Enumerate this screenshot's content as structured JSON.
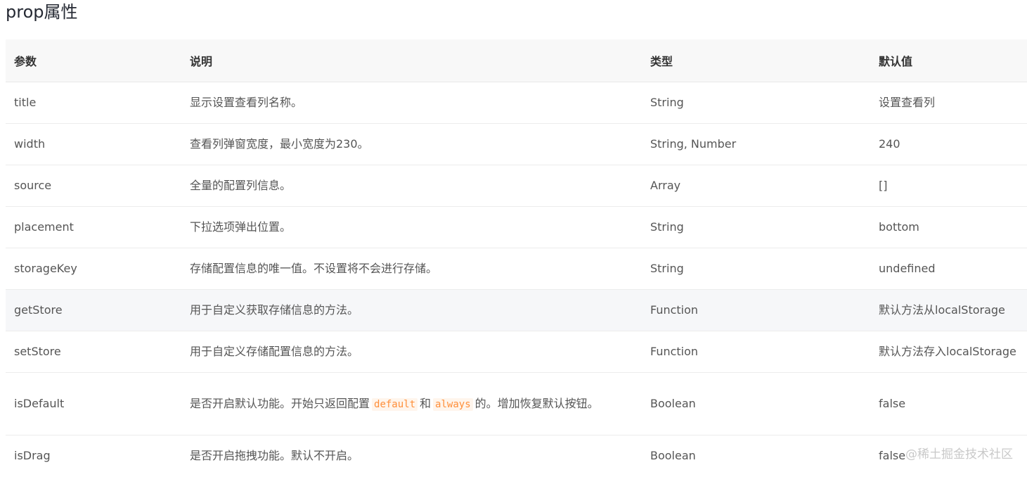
{
  "heading": "prop属性",
  "table": {
    "headers": [
      "参数",
      "说明",
      "类型",
      "默认值"
    ],
    "rows": [
      {
        "param": "title",
        "desc": "显示设置查看列名称。",
        "type": "String",
        "default": "设置查看列"
      },
      {
        "param": "width",
        "desc": "查看列弹窗宽度，最小宽度为230。",
        "type": "String, Number",
        "default": "240"
      },
      {
        "param": "source",
        "desc": "全量的配置列信息。",
        "type": "Array",
        "default": "[]"
      },
      {
        "param": "placement",
        "desc": "下拉选项弹出位置。",
        "type": "String",
        "default": "bottom"
      },
      {
        "param": "storageKey",
        "desc": "存储配置信息的唯一值。不设置将不会进行存储。",
        "type": "String",
        "default": "undefined"
      },
      {
        "param": "getStore",
        "desc": "用于自定义获取存储信息的方法。",
        "type": "Function",
        "default": "默认方法从localStorage"
      },
      {
        "param": "setStore",
        "desc": "用于自定义存储配置信息的方法。",
        "type": "Function",
        "default": "默认方法存入localStorage"
      },
      {
        "param": "isDefault",
        "desc_parts": {
          "pre": "是否开启默认功能。开始只返回配置",
          "code1": "default",
          "mid": "和",
          "code2": "always",
          "post": "的。增加恢复默认按钮。"
        },
        "type": "Boolean",
        "default": "false"
      },
      {
        "param": "isDrag",
        "desc": "是否开启拖拽功能。默认不开启。",
        "type": "Boolean",
        "default": "false"
      }
    ]
  },
  "watermark": "@稀土掘金技术社区",
  "colors": {
    "heading": "#252933",
    "header_bg": "#f8f8f8",
    "highlight_row_bg": "#f6f7f9",
    "code_text": "#ff8f3a",
    "code_bg": "#fff5ec",
    "watermark": "#c9c9c9"
  }
}
